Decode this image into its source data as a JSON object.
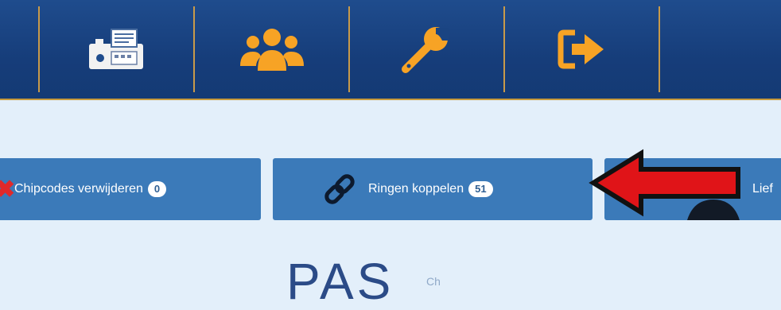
{
  "topbar": {
    "nav": [
      {
        "icon": "clinic-scanner-icon"
      },
      {
        "icon": "users-icon"
      },
      {
        "icon": "wrench-icon"
      },
      {
        "icon": "logout-icon"
      }
    ],
    "colors": {
      "background": "#173f7c",
      "accent": "#f7a325",
      "separator": "#c89a4a"
    }
  },
  "actions": {
    "chipcodes": {
      "label": "Chipcodes verwijderen",
      "count": "0"
    },
    "ringen": {
      "label": "Ringen koppelen",
      "count": "51",
      "icon": "link-icon"
    },
    "third": {
      "label": "Lief",
      "icon": "partial-icon"
    }
  },
  "annotation": {
    "icon": "red-arrow-pointer"
  },
  "logo": {
    "text": "PAS",
    "sub": "Ch"
  }
}
